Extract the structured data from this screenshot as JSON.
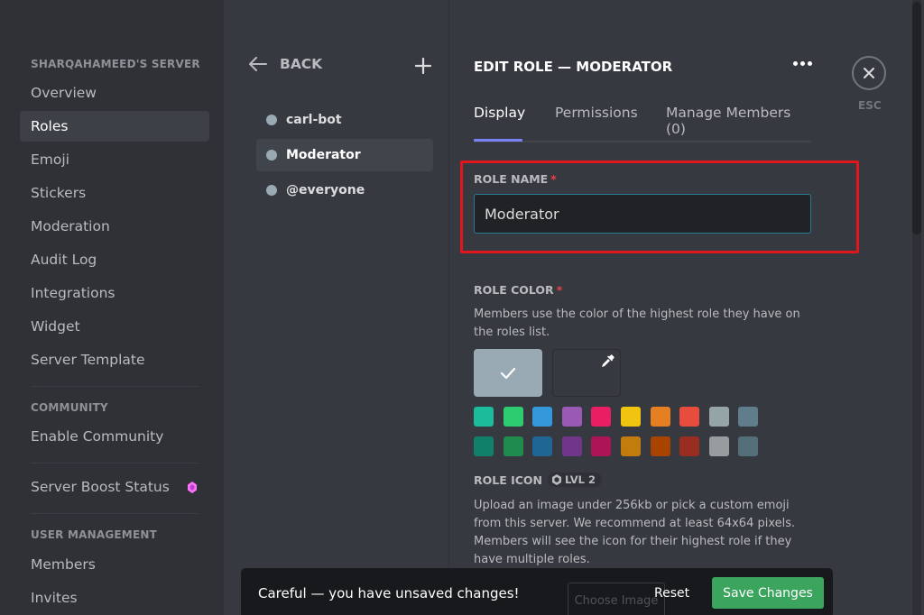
{
  "sidebar": {
    "server_header": "SHARQAHAMEED'S SERVER",
    "items_main": [
      {
        "label": "Overview"
      },
      {
        "label": "Roles",
        "active": true
      },
      {
        "label": "Emoji"
      },
      {
        "label": "Stickers"
      },
      {
        "label": "Moderation"
      },
      {
        "label": "Audit Log"
      },
      {
        "label": "Integrations"
      },
      {
        "label": "Widget"
      },
      {
        "label": "Server Template"
      }
    ],
    "community_header": "COMMUNITY",
    "enable_community": "Enable Community",
    "server_boost": "Server Boost Status",
    "boost_icon_color": "#ff73fa",
    "user_management_header": "USER MANAGEMENT",
    "members": "Members",
    "invites": "Invites"
  },
  "roles_panel": {
    "back_label": "BACK",
    "add_icon": "plus-icon",
    "roles": [
      {
        "name": "carl-bot"
      },
      {
        "name": "Moderator",
        "active": true
      },
      {
        "name": "@everyone"
      }
    ]
  },
  "edit": {
    "title": "EDIT ROLE — MODERATOR",
    "tabs": [
      {
        "label": "Display",
        "active": true
      },
      {
        "label": "Permissions"
      },
      {
        "label": "Manage Members (0)"
      }
    ],
    "role_name_label": "ROLE NAME",
    "required_mark": "*",
    "role_name_value": "Moderator",
    "role_color_label": "ROLE COLOR",
    "role_color_desc": "Members use the color of the highest role they have on the roles list.",
    "default_color": "#99aab5",
    "swatches_row1": [
      "#1abc9c",
      "#2ecc71",
      "#3498db",
      "#9b59b6",
      "#e91e63",
      "#f1c40f",
      "#e67e22",
      "#e74c3c",
      "#95a5a6",
      "#607d8b"
    ],
    "swatches_row2": [
      "#11806a",
      "#1f8b4c",
      "#206694",
      "#71368a",
      "#ad1457",
      "#c27c0e",
      "#a84300",
      "#992d22",
      "#979c9f",
      "#546e7a"
    ],
    "role_icon_label": "ROLE ICON",
    "role_icon_badge": "LVL 2",
    "role_icon_desc": "Upload an image under 256kb or pick a custom emoji from this server. We recommend at least 64x64 pixels. Members will see the icon for their highest role if they have multiple roles.",
    "esc_label": "ESC"
  },
  "unsaved_bar": {
    "message": "Careful — you have unsaved changes!",
    "choose_image": "Choose Image",
    "reset": "Reset",
    "save": "Save Changes"
  },
  "colors": {
    "accent_tab": "#7983f5",
    "save_green": "#3ba55d",
    "highlight_red": "#e0161c"
  }
}
